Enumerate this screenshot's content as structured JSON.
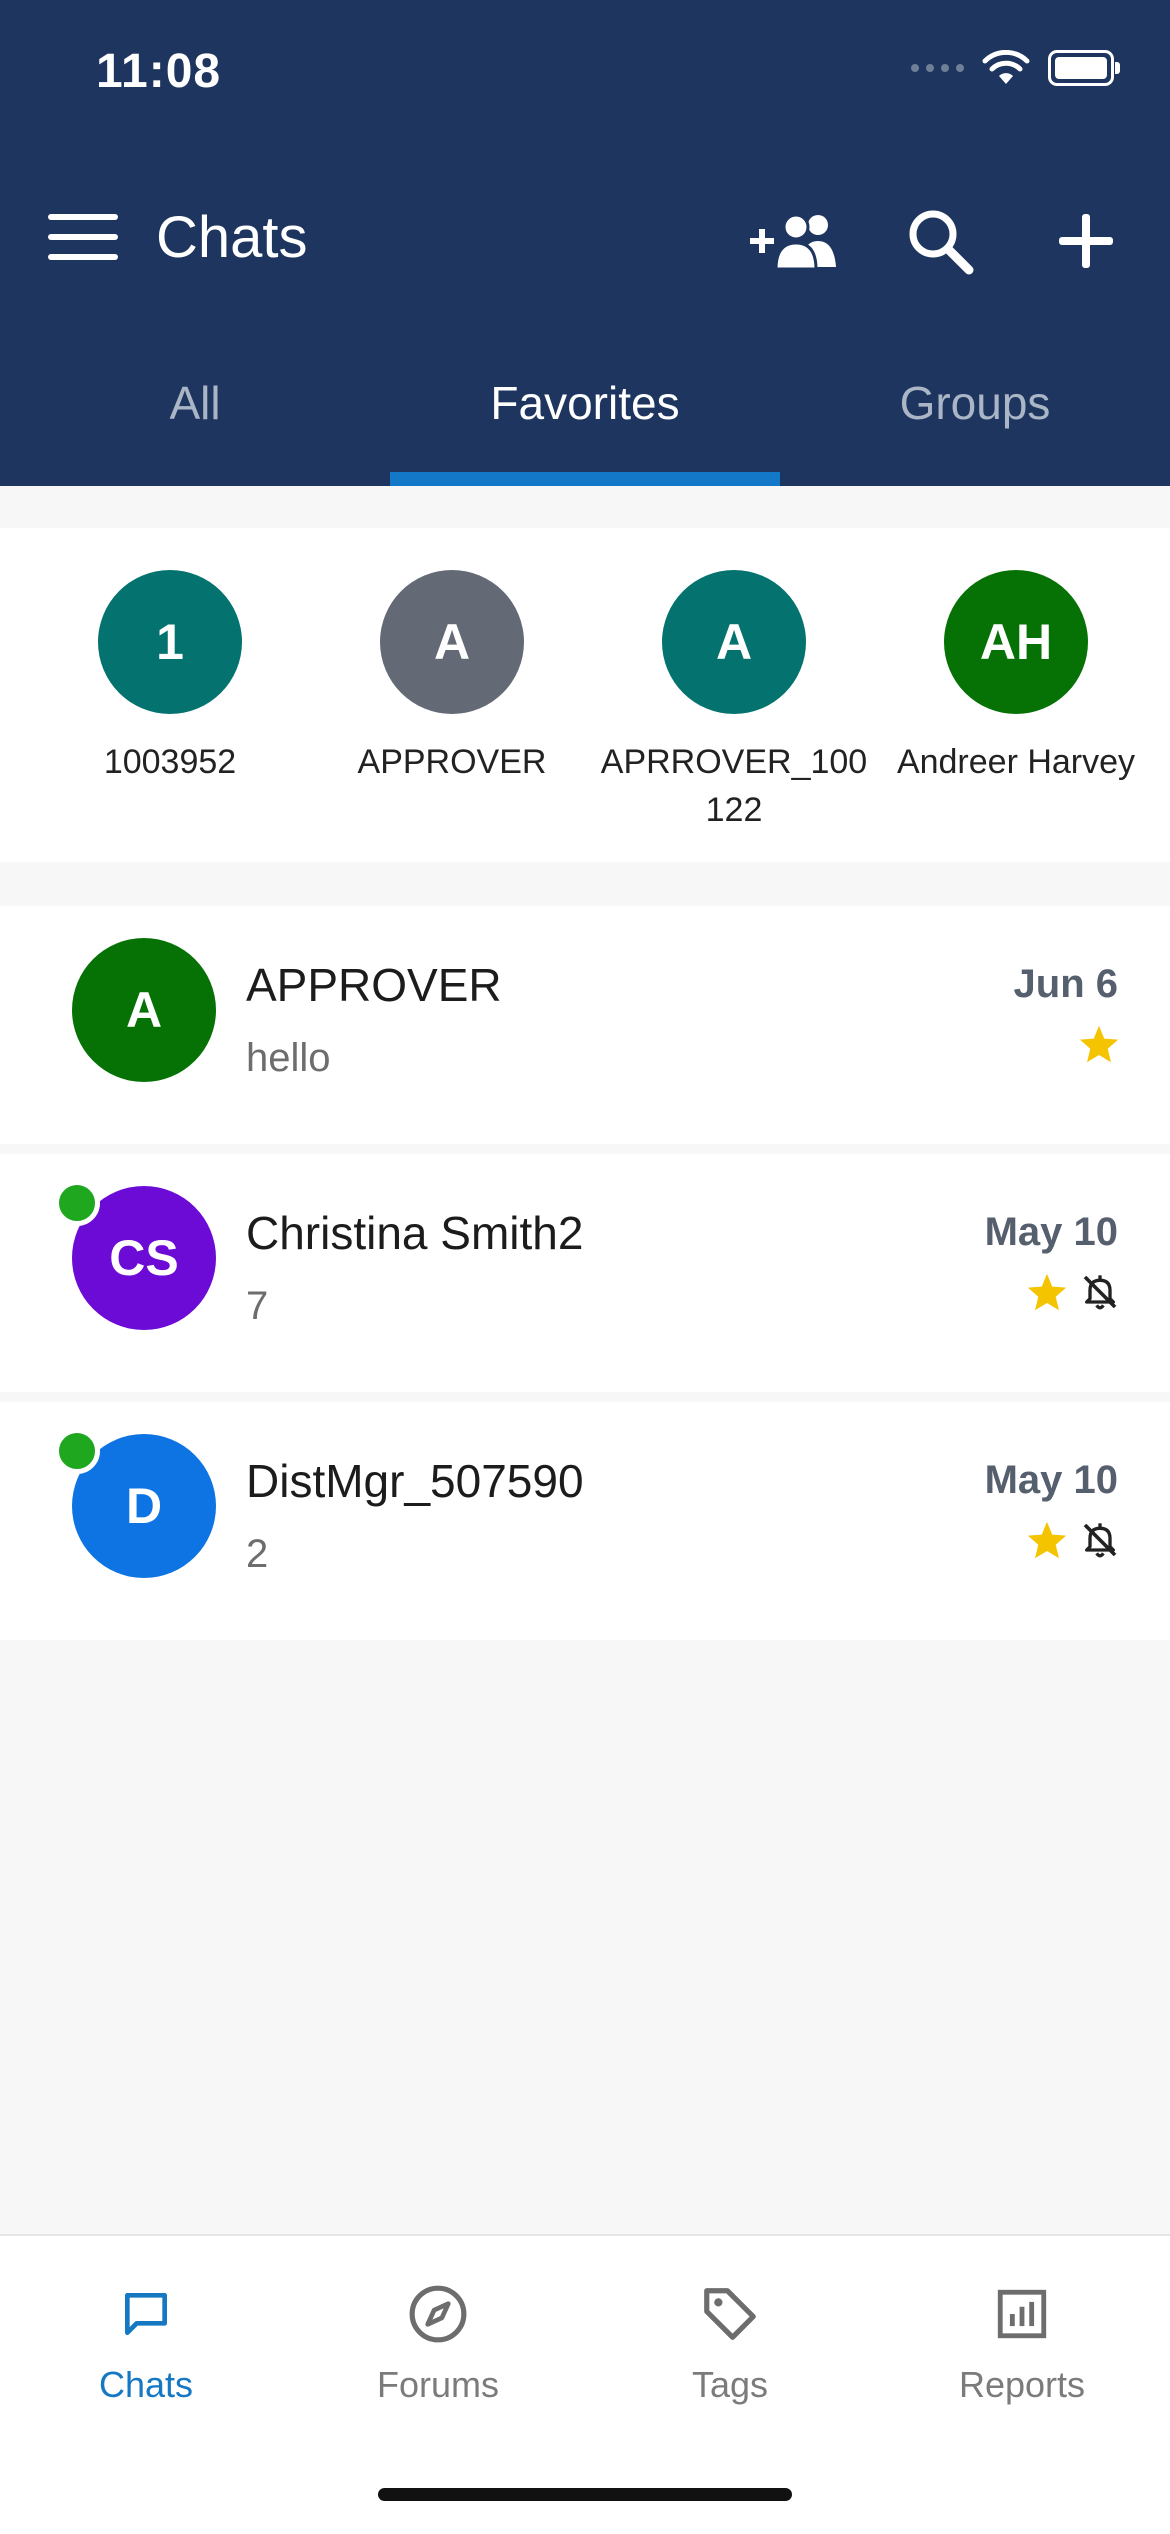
{
  "status_bar": {
    "time": "11:08"
  },
  "header": {
    "title": "Chats"
  },
  "tabs": [
    {
      "label": "All",
      "active": false
    },
    {
      "label": "Favorites",
      "active": true
    },
    {
      "label": "Groups",
      "active": false
    }
  ],
  "favorites": [
    {
      "initials": "1",
      "name": "1003952",
      "color": "#04736f"
    },
    {
      "initials": "A",
      "name": "APPROVER",
      "color": "#636a75"
    },
    {
      "initials": "A",
      "name": "APRROVER_100122",
      "color": "#04736f"
    },
    {
      "initials": "AH",
      "name": "Andreer Harvey",
      "color": "#067206"
    }
  ],
  "chats": [
    {
      "initials": "A",
      "name": "APPROVER",
      "message": "hello",
      "date": "Jun 6",
      "color": "#067206",
      "online": false,
      "starred": true,
      "muted": false
    },
    {
      "initials": "CS",
      "name": "Christina Smith2",
      "message": "7",
      "date": "May 10",
      "color": "#6c0ad6",
      "online": true,
      "starred": true,
      "muted": true
    },
    {
      "initials": "D",
      "name": "DistMgr_507590",
      "message": "2",
      "date": "May 10",
      "color": "#0e74e4",
      "online": true,
      "starred": true,
      "muted": true
    }
  ],
  "bottom_nav": [
    {
      "label": "Chats",
      "icon": "chat-bubble-icon",
      "active": true
    },
    {
      "label": "Forums",
      "icon": "compass-icon",
      "active": false
    },
    {
      "label": "Tags",
      "icon": "tag-icon",
      "active": false
    },
    {
      "label": "Reports",
      "icon": "bar-chart-icon",
      "active": false
    }
  ],
  "colors": {
    "header_bg": "#1e365f",
    "tab_indicator": "#1478c8",
    "accent": "#1678c2",
    "star": "#f5c400",
    "online": "#1fa81f"
  }
}
